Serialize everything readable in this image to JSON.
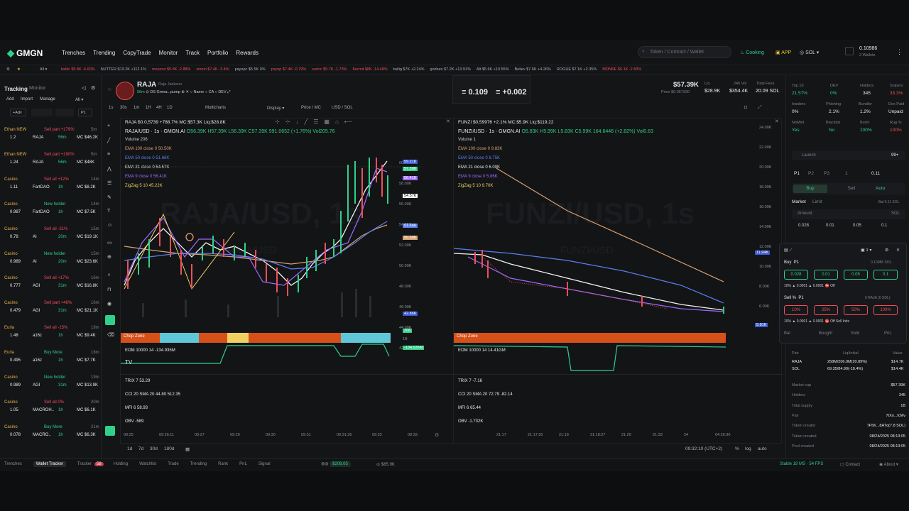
{
  "nav": {
    "logo": "GMGN",
    "items": [
      "Trenches",
      "Trending",
      "CopyTrade",
      "Monitor",
      "Track",
      "Portfolio",
      "Rewards"
    ],
    "search_placeholder": "Token / Contract / Wallet",
    "cooking": "Cooking",
    "app": "APP",
    "chain": "SOL",
    "balance": "0.10986",
    "wallets": "2 Wallets"
  },
  "ticker": [
    "baltic $5.8K -6.60%",
    "NUTTER $13.2K +112.1%",
    "moanco $5.8K -2.88%",
    "sinnin $7.4K -3.4%",
    "payopc $5.5K 0%",
    "psyop $7.4K -0.79%",
    "somic $5.7K -1.73%",
    "Kermit $8K -14.48%",
    "twilig $7K +2.24%",
    "godsen $7.2K +13.91%",
    "Alt $5.6K +10.55%",
    "Believ $7.6K +4.26%",
    "ROGUE $7.1K +2.35%",
    "MONKE $6.1K -2.83%"
  ],
  "tracking": {
    "tab1": "Tracking",
    "tab2": "Monitor",
    "add": "Add",
    "import": "Import",
    "manage": "Manage",
    "all": "All",
    "adv": "Adv",
    "p1": "P1"
  },
  "trades": [
    {
      "name": "Ethan NEW",
      "action": "Sell part +179%",
      "time": "5m",
      "amt": "1.2",
      "token": "RAJA",
      "age": "56m",
      "mc": "MC $46.2K",
      "color": "r"
    },
    {
      "name": "Ethan NEW",
      "action": "Sell part +190%",
      "time": "5m",
      "amt": "1.24",
      "token": "RAJA",
      "age": "56m",
      "mc": "MC $48K",
      "color": "r"
    },
    {
      "name": "Casino",
      "action": "Sell all +12%",
      "time": "14m",
      "amt": "1.11",
      "token": "FartDAO",
      "age": "1h",
      "mc": "MC $8.2K",
      "color": "r"
    },
    {
      "name": "Casino",
      "action": "New holder",
      "time": "14m",
      "amt": "0.987",
      "token": "FartDAO",
      "age": "1h",
      "mc": "MC $7.5K",
      "color": "g"
    },
    {
      "name": "Casino",
      "action": "Sell all -21%",
      "time": "15m",
      "amt": "0.78",
      "token": "AI",
      "age": "20m",
      "mc": "MC $19.1K",
      "color": "r"
    },
    {
      "name": "Casino",
      "action": "New holder",
      "time": "15m",
      "amt": "0.989",
      "token": "AI",
      "age": "20m",
      "mc": "MC $23.6K",
      "color": "g"
    },
    {
      "name": "Casino",
      "action": "Sell all +17%",
      "time": "16m",
      "amt": "0.777",
      "token": "AGI",
      "age": "31m",
      "mc": "MC $16.8K",
      "color": "r"
    },
    {
      "name": "Casino",
      "action": "Sell part +46%",
      "time": "16m",
      "amt": "0.479",
      "token": "AGI",
      "age": "31m",
      "mc": "MC $21.1K",
      "color": "r"
    },
    {
      "name": "Eurla",
      "action": "Sell all -15%",
      "time": "18m",
      "amt": "1.48",
      "token": "a16z",
      "age": "1h",
      "mc": "MC $9.4K",
      "color": "r"
    },
    {
      "name": "Eurla",
      "action": "Buy More",
      "time": "18m",
      "amt": "0.495",
      "token": "a16z",
      "age": "1h",
      "mc": "MC $7.7K",
      "color": "g"
    },
    {
      "name": "Casino",
      "action": "New holder",
      "time": "19m",
      "amt": "0.989",
      "token": "AGI",
      "age": "31m",
      "mc": "MC $13.9K",
      "color": "g"
    },
    {
      "name": "Casino",
      "action": "Sell all 0%",
      "time": "20m",
      "amt": "1.05",
      "token": "MACROH..",
      "age": "1h",
      "mc": "MC $6.1K",
      "color": "r"
    },
    {
      "name": "Casino",
      "action": "Buy More",
      "time": "21m",
      "amt": "0.078",
      "token": "MACRO..",
      "age": "1h",
      "mc": "MC $6.3K",
      "color": "g"
    }
  ],
  "token": {
    "name": "RAJA",
    "sub": "Raja Jackson",
    "age": "56m",
    "ds": "DS",
    "mint": "Gmna...pump",
    "links": [
      "Name",
      "CA",
      "DEV"
    ],
    "price": "$57.39K",
    "price_sub": "Price $0.057390",
    "liq_label": "Liq",
    "liq": "$28.9K",
    "vol_label": "24h Vol",
    "vol": "$354.4K",
    "fees_label": "Total Fees",
    "fees": "20.09 SOL",
    "top10_label": "Top 10",
    "top10": "21.57%",
    "dev_label": "DEV",
    "dev": "0%",
    "holders_label": "Holders",
    "holders": "345",
    "snipers_label": "Snipers",
    "snipers": "33.3%",
    "insiders_label": "Insiders",
    "insiders": "0%",
    "phishing_label": "Phishing",
    "phishing": "2.1%",
    "bundler_label": "Bundler",
    "bundler": "1.2%",
    "dexpaid_label": "Dex Paid",
    "dexpaid": "Unpaid",
    "nomint_label": "NoMint",
    "nomint": "Yes",
    "blacklist_label": "Blacklist",
    "blacklist": "No",
    "burnt_label": "Burnt",
    "burnt": "100%",
    "rug_label": "Rug %",
    "rug": "100%"
  },
  "center_badge": {
    "left": "0.109",
    "right": "+0.002"
  },
  "chart_toolbar": {
    "intervals": [
      "1s",
      "30s",
      "1m",
      "1H",
      "4H",
      "1D"
    ],
    "multicharts": "Multicharts",
    "display": "Display",
    "pricemc": "Price / MC",
    "usdsol": "USD / SOL"
  },
  "chart_left": {
    "title": "RAJA $0.0,5739 +788.7%  MC:$57.3K  Liq:$28.8K",
    "pair": "RAJA/USD · 1s · GMGN.AI",
    "ohlc": "O56.39K H57.39K L56.39K C57.39K 991.0652 (+1.76%) Vol205.76",
    "vol": "Volume 206",
    "emas": [
      "EMA 100 close 0  50.50K",
      "EMA 50 close 0  51.66K",
      "EMA 21 close 0  54.57K",
      "EMA 9 close 0  56.41K",
      "ZigZag 5 10  45.22K"
    ],
    "watermark": "RAJA/USD, 1s",
    "wm2": "RAJA/USD",
    "prices": [
      "60.00K",
      "58.00K",
      "56.00K",
      "54.00K",
      "52.00K",
      "50.00K",
      "48.00K",
      "46.00K",
      "44.00K",
      "42.00K"
    ],
    "high": "59.21K",
    "low": "42.86K",
    "tags": [
      "57.39K",
      "56.41K",
      "54.57K",
      "51.66K",
      "50.50K"
    ],
    "chop": "Chop Zone",
    "eom": "EOM 10000 14  -134.935M",
    "trix": "TRIX 7  53.29",
    "cci": "CCI 20 SMA 20  44.80  512.35",
    "mfi": "MFI 6  58.93",
    "obv": "OBV  -589",
    "times": [
      "09:25",
      "09:26:11",
      "09:27",
      "09:29",
      "09:30",
      "09:31",
      "09:31:36",
      "09:32",
      "09:32:"
    ],
    "ind_vals": [
      "206",
      "1B",
      "-134.935M"
    ]
  },
  "chart_right": {
    "title": "FUNZI $0,59976 +2.1%  MC:$5.9K  Liq:$119.22",
    "pair": "FUNZI/USD · 1s · GMGN.AI",
    "ohlc": "O5.83K H5.99K L5.83K C5.99K 164.6446 (+2.82%) Vol0.63",
    "vol": "Volume 1",
    "emas": [
      "EMA 100 close 0  9.83K",
      "EMA 50 close 0  8.75K",
      "EMA 21 close 0  6.00K",
      "EMA 9 close 0  5.86K",
      "ZigZag 5 10  9.70K"
    ],
    "watermark": "FUNZI/USD, 1s",
    "wm2": "FUNZI/USD",
    "prices": [
      "24.00K",
      "22.00K",
      "20.00K",
      "18.00K",
      "16.00K",
      "14.00K",
      "12.00K",
      "10.00K",
      "8.00K",
      "6.00K"
    ],
    "high": "11.94K",
    "low": "5.81K",
    "eom": "EOM 10000 14  14.41GM",
    "trix": "TRIX 7  -7.16",
    "cci": "CCI 20 SMA 20  72.79  -82.14",
    "mfi": "MFI 6  65.44",
    "obv": "OBV  -1.732K",
    "times": [
      "21:17",
      "21:17:30",
      "21:18",
      "21:18:27",
      "21:20",
      "21:33",
      "24",
      "04:26:30"
    ]
  },
  "chart_bottom": {
    "ranges": [
      "1d",
      "7d",
      "30d",
      "180d"
    ],
    "clock": "09:32:10 (UTC+2)",
    "pct": "%",
    "log": "log",
    "auto": "auto"
  },
  "trade": {
    "p": [
      "P1",
      "P2",
      "P3"
    ],
    "p_count": "1",
    "balance": "0.11",
    "buy": "Buy",
    "sell": "Sell",
    "auto": "Auto",
    "market": "Market",
    "limit": "Limit",
    "bal_label": "Bal 0.11 SOL",
    "amount": "Amount",
    "amount_unit": "SOL",
    "presets": [
      "0.028",
      "0.01",
      "0.05",
      "0.1"
    ],
    "launch": "Launch",
    "launch_val": "99+"
  },
  "quick": {
    "buy_label": "Buy",
    "buy_p": "P1",
    "bal": "0.10986 SOL",
    "buy_presets": [
      "0.028",
      "0.01",
      "0.05",
      "0.1"
    ],
    "fee1": "0.0001",
    "fee2": "0.0001",
    "off": "Off",
    "sell_label": "Sell %",
    "sell_p": "P1",
    "sell_bal": "0 RAJA (0 SOL)",
    "sell_presets": [
      "10%",
      "25%",
      "50%",
      "100%"
    ],
    "off2": "Off Sell Inits",
    "cols": [
      "Bal",
      "Bought",
      "Sold",
      "PnL"
    ]
  },
  "pair_info": {
    "cols": [
      "Pair",
      "Liq/Initial",
      "Value"
    ],
    "rows": [
      {
        "a": "RAJA",
        "b": "258M/206.9M(20.89%)",
        "c": "$14.7K"
      },
      {
        "a": "SOL",
        "b": "69.35/84.90(-18.4%)",
        "c": "$14.4K"
      }
    ],
    "kv": [
      {
        "k": "Market cap",
        "v": "$57.39K"
      },
      {
        "k": "Holders",
        "v": "345"
      },
      {
        "k": "Total supply",
        "v": "1B"
      },
      {
        "k": "Pair",
        "v": "7tXo...fcMv"
      },
      {
        "k": "Token creator",
        "v": "7F5K...8ATq(7.8 SOL)"
      },
      {
        "k": "Token created",
        "v": "08/24/2025 08:13:05"
      },
      {
        "k": "Pool created",
        "v": "08/24/2025 08:13:05"
      }
    ]
  },
  "footer": {
    "items": [
      "Trenches",
      "Wallet Tracker",
      "Tracker",
      "Holding",
      "Watchlist",
      "Trade",
      "Trending",
      "Rank",
      "PnL",
      "Signal"
    ],
    "tracker_badge": "58",
    "price1": "$208.05",
    "price2": "$85.9K",
    "stable": "Stable 18 MS · 54 FPS",
    "contact": "Contact",
    "about": "About"
  },
  "colors": {
    "green": "#2fd08a",
    "red": "#ef4e5a",
    "bg": "#141517"
  }
}
